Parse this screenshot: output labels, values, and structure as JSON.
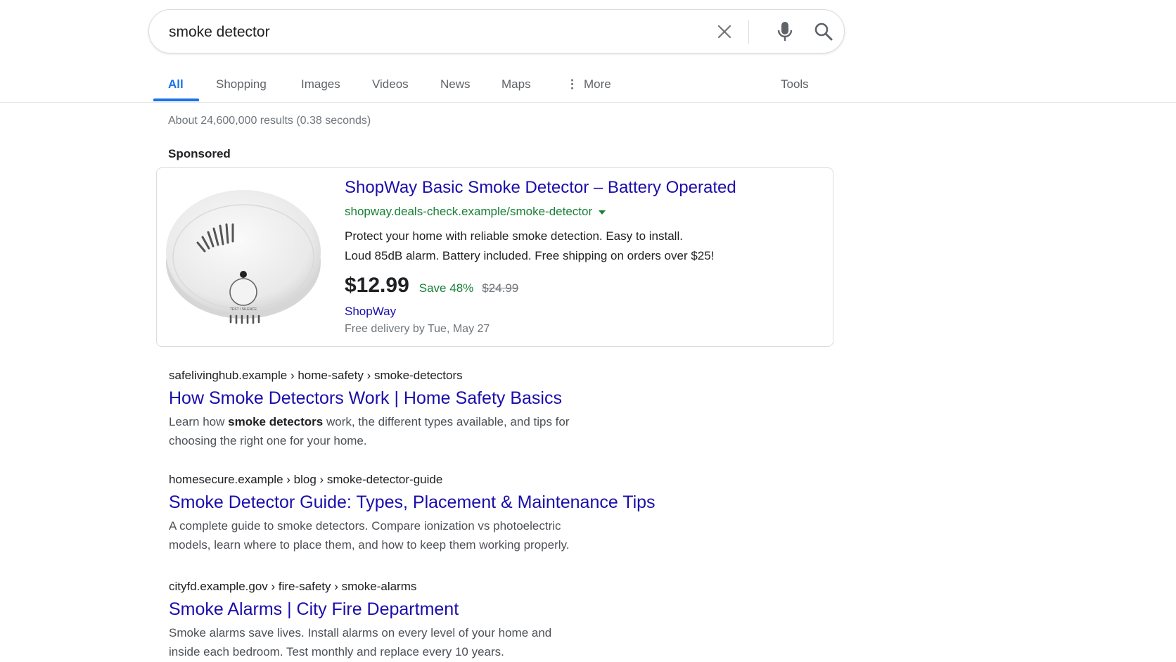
{
  "search": {
    "query": "smoke detector"
  },
  "tabs": [
    {
      "label": "All"
    },
    {
      "label": "Shopping"
    },
    {
      "label": "Images"
    },
    {
      "label": "Videos"
    },
    {
      "label": "News"
    },
    {
      "label": "Maps"
    },
    {
      "label": "More"
    },
    {
      "label": "Tools"
    }
  ],
  "stats": "About 24,600,000 results (0.38 seconds)",
  "sponsored_label": "Sponsored",
  "ad": {
    "image_icon": "smoke-detector-product-image",
    "title": "ShopWay Basic Smoke Detector – Battery Operated",
    "url": "shopway.deals-check.example/smoke-detector",
    "desc_line1": "Protect your home with reliable smoke detection. Easy to install.",
    "desc_line2": "Loud 85dB alarm. Battery included. Free shipping on orders over $25!",
    "price": "$12.99",
    "save": "Save 48%",
    "old_price": "$24.99",
    "merchant": "ShopWay",
    "delivery": "Free delivery by Tue, May 27",
    "detector_label": "TEST / SILENCE"
  },
  "results": [
    {
      "crumb": "safelivinghub.example › home-safety › smoke-detectors",
      "title": "How Smoke Detectors Work | Home Safety Basics",
      "snippet_pre": "Learn how ",
      "snippet_bold": "smoke detectors",
      "snippet_post": " work, the different types available, and tips for",
      "snippet_line2": "choosing the right one for your home."
    },
    {
      "crumb": "homesecure.example › blog › smoke-detector-guide",
      "title": "Smoke Detector Guide: Types, Placement & Maintenance Tips",
      "snippet_line1": "A complete guide to smoke detectors. Compare ionization vs photoelectric",
      "snippet_line2": "models, learn where to place them, and how to keep them working properly."
    },
    {
      "crumb": "cityfd.example.gov › fire-safety › smoke-alarms",
      "title": "Smoke Alarms | City Fire Department",
      "snippet_line1": "Smoke alarms save lives. Install alarms on every level of your home and",
      "snippet_line2": "inside each bedroom. Test monthly and replace every 10 years."
    }
  ],
  "colors": {
    "link": "#1a0dab",
    "accent": "#1a73e8",
    "url_green": "#188038"
  }
}
